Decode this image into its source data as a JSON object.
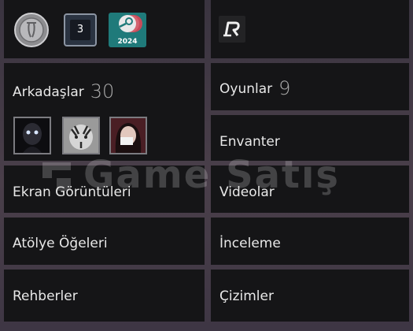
{
  "badges": {
    "level_badge": "3",
    "steam_year_badge": "2024",
    "icons": [
      "coin-icon",
      "steam-icon",
      "game-logo-icon"
    ]
  },
  "friends": {
    "label": "Arkadaşlar",
    "count": "30"
  },
  "games": {
    "label": "Oyunlar",
    "count": "9"
  },
  "links": {
    "inventory": "Envanter",
    "screenshots": "Ekran Görüntüleri",
    "videos": "Videolar",
    "workshop": "Atölye Öğeleri",
    "reviews": "İnceleme",
    "guides": "Rehberler",
    "artwork": "Çizimler"
  },
  "watermark": "Game Satış",
  "colors": {
    "panel_bg": "#151517",
    "page_bg": "#3a3440",
    "text": "#e8e8e8",
    "count": "#a9a9a9",
    "steam_badge": "#1f7a7a"
  }
}
